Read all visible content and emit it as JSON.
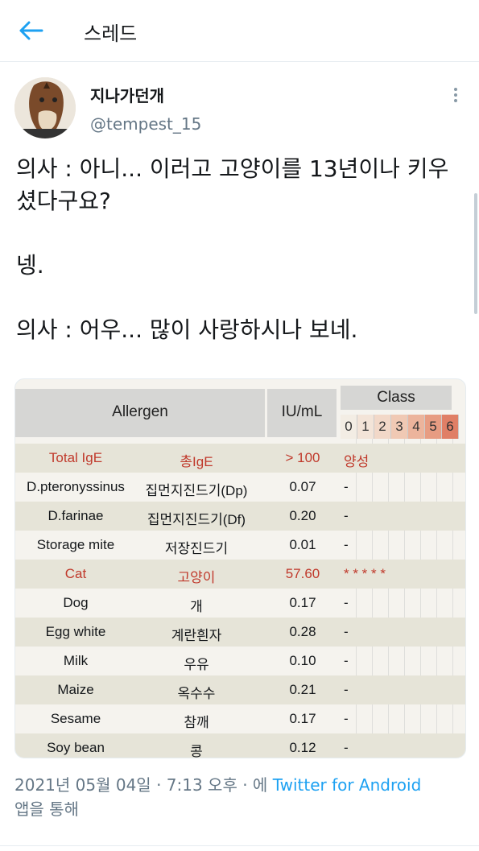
{
  "header": {
    "title": "스레드"
  },
  "user": {
    "name": "지나가던개",
    "handle": "@tempest_15"
  },
  "tweet": {
    "lines": [
      "의사 : 아니... 이러고 고양이를 13년이나 키우셨다구요?",
      "넹.",
      "의사 : 어우... 많이 사랑하시나 보네."
    ]
  },
  "photo": {
    "headers": {
      "allergen": "Allergen",
      "unit": "IU/mL",
      "class": "Class"
    },
    "class_numbers": [
      "0",
      "1",
      "2",
      "3",
      "4",
      "5",
      "6"
    ],
    "rows": [
      {
        "en": "Total IgE",
        "ko": "총IgE",
        "val": "> 100",
        "cls": "양성",
        "red": true
      },
      {
        "en": "D.pteronyssinus",
        "ko": "집먼지진드기(Dp)",
        "val": "0.07",
        "cls": "-"
      },
      {
        "en": "D.farinae",
        "ko": "집먼지진드기(Df)",
        "val": "0.20",
        "cls": "-"
      },
      {
        "en": "Storage mite",
        "ko": "저장진드기",
        "val": "0.01",
        "cls": "-"
      },
      {
        "en": "Cat",
        "ko": "고양이",
        "val": "57.60",
        "cls": "* * * * *",
        "red": true
      },
      {
        "en": "Dog",
        "ko": "개",
        "val": "0.17",
        "cls": "-"
      },
      {
        "en": "Egg white",
        "ko": "계란흰자",
        "val": "0.28",
        "cls": "-"
      },
      {
        "en": "Milk",
        "ko": "우유",
        "val": "0.10",
        "cls": "-"
      },
      {
        "en": "Maize",
        "ko": "옥수수",
        "val": "0.21",
        "cls": "-"
      },
      {
        "en": "Sesame",
        "ko": "참깨",
        "val": "0.17",
        "cls": "-"
      },
      {
        "en": "Soy bean",
        "ko": "콩",
        "val": "0.12",
        "cls": "-"
      }
    ]
  },
  "meta": {
    "timestamp": "2021년 05월 04일 · 7:13 오후 · 에 ",
    "source": "Twitter for Android",
    "suffix": "앱을 통해"
  },
  "colors": {
    "accent": "#1da1f2",
    "positive": "#c0392b"
  },
  "icons": {
    "back": "arrow-left-icon",
    "more": "more-vertical-icon"
  }
}
